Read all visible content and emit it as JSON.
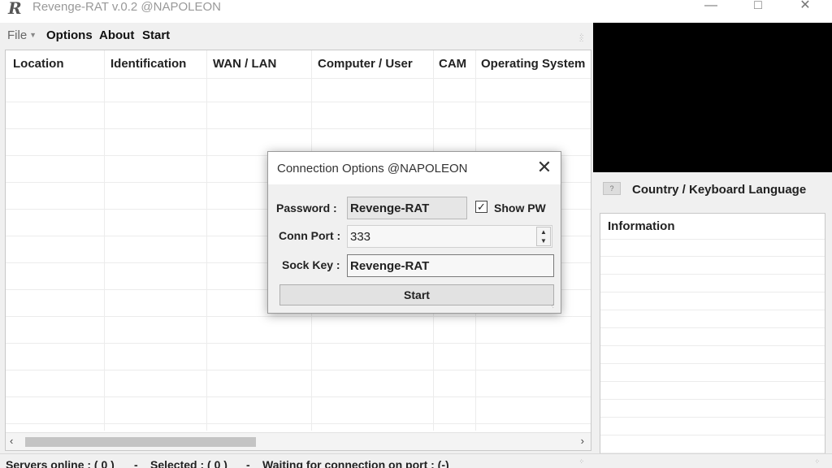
{
  "window": {
    "title": "Revenge-RAT v.0.2 @NAPOLEON",
    "app_icon_glyph": "R",
    "minimize_glyph": "—",
    "maximize_glyph": "□",
    "close_glyph": "✕"
  },
  "menu": {
    "file": "File",
    "options": "Options",
    "about": "About",
    "start": "Start"
  },
  "table": {
    "columns": [
      "Location",
      "Identification",
      "WAN / LAN",
      "Computer / User",
      "CAM",
      "Operating System"
    ],
    "scroll_left_glyph": "‹",
    "scroll_right_glyph": "›"
  },
  "right_panel": {
    "flag_glyph": "?",
    "country_header": "Country / Keyboard Language",
    "information_header": "Information"
  },
  "status": {
    "servers_online": "Servers online : ( 0 )",
    "sep1": "-",
    "selected": "Selected : ( 0 )",
    "sep2": "-",
    "waiting": "Waiting for connection on port : (-)"
  },
  "dialog": {
    "title": "Connection Options @NAPOLEON",
    "close_glyph": "✕",
    "password_label": "Password :",
    "password_value": "Revenge-RAT",
    "show_pw_label": "Show PW",
    "show_pw_checked": true,
    "check_glyph": "✓",
    "port_label": "Conn Port :",
    "port_value": "333",
    "spin_up": "▲",
    "spin_down": "▼",
    "sock_label": "Sock Key :",
    "sock_value": "Revenge-RAT",
    "start_label": "Start"
  },
  "colors": {
    "window_bg": "#f0f0f0",
    "preview_bg": "#000000",
    "list_bg": "#ffffff"
  }
}
